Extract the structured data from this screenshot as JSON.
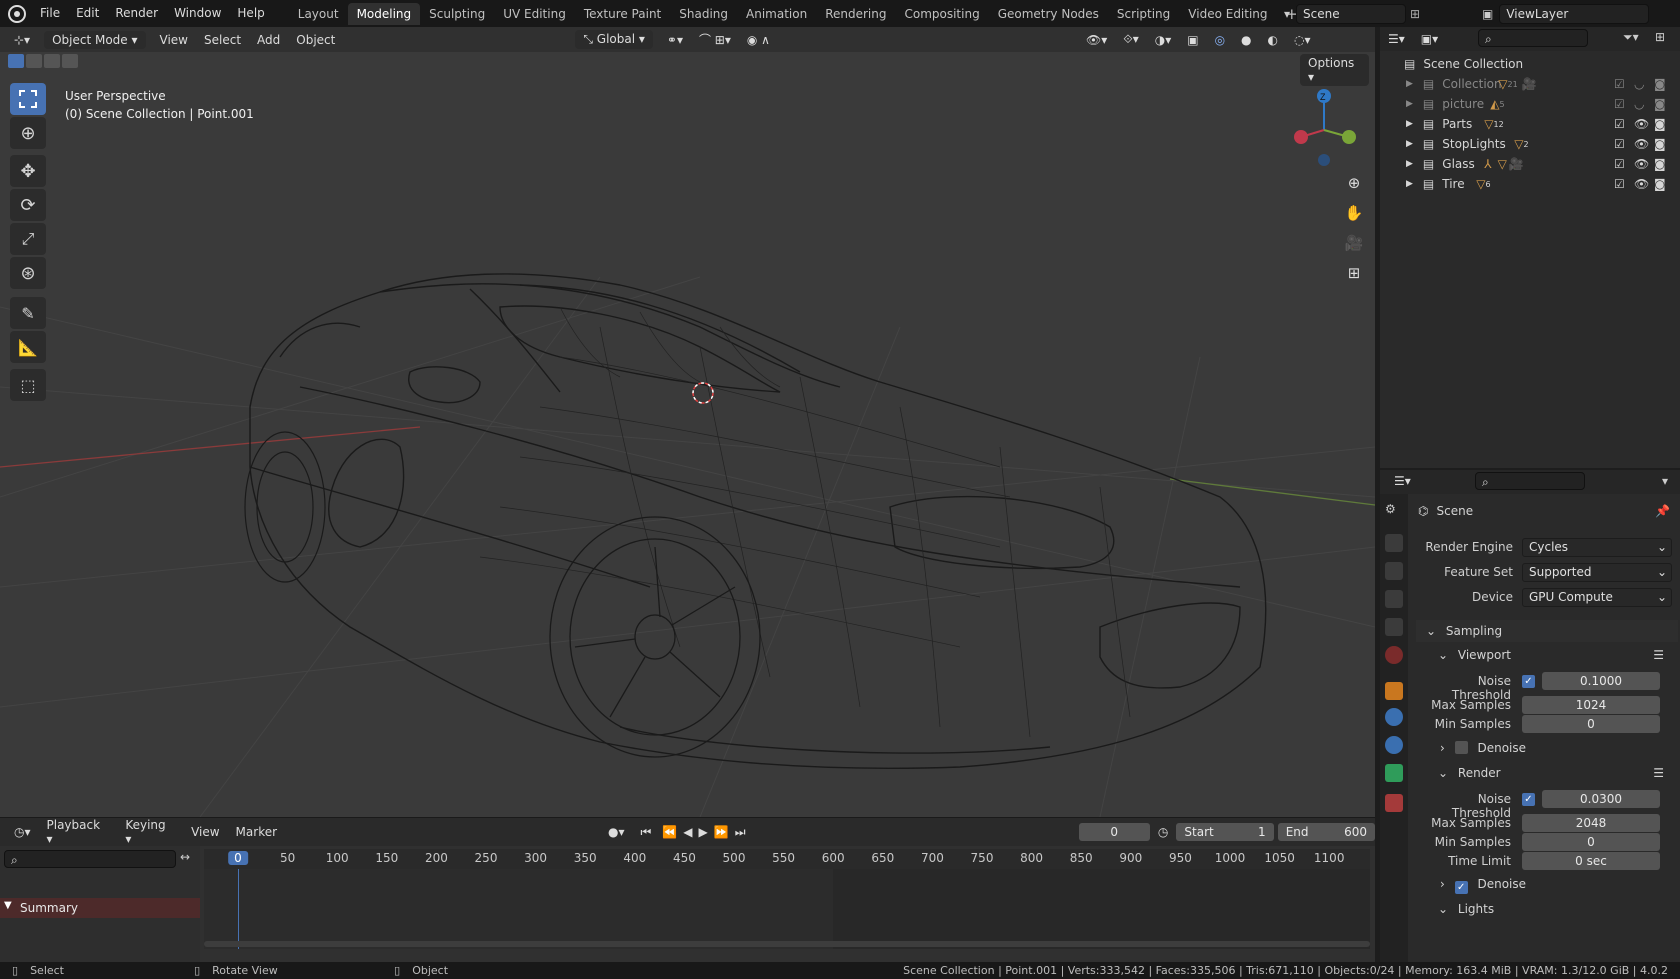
{
  "menu": [
    "File",
    "Edit",
    "Render",
    "Window",
    "Help"
  ],
  "workspaces": [
    "Layout",
    "Modeling",
    "Sculpting",
    "UV Editing",
    "Texture Paint",
    "Shading",
    "Animation",
    "Rendering",
    "Compositing",
    "Geometry Nodes",
    "Scripting",
    "Video Editing"
  ],
  "active_workspace": "Modeling",
  "scene_name": "Scene",
  "view_layer": "ViewLayer",
  "viewport": {
    "mode": "Object Mode",
    "menus": [
      "View",
      "Select",
      "Add",
      "Object"
    ],
    "transform_orientation": "Global",
    "options_label": "Options",
    "info_line1": "User Perspective",
    "info_line2": "(0) Scene Collection | Point.001",
    "gizmo_z": "Z"
  },
  "timeline": {
    "menus": [
      "Playback",
      "Keying",
      "View",
      "Marker"
    ],
    "current_frame": "0",
    "start_label": "Start",
    "start": "1",
    "end_label": "End",
    "end": "600",
    "ticks": [
      "0",
      "50",
      "100",
      "150",
      "200",
      "250",
      "300",
      "350",
      "400",
      "450",
      "500",
      "550",
      "600",
      "650",
      "700",
      "750",
      "800",
      "850",
      "900",
      "950",
      "1000",
      "1050",
      "1100"
    ],
    "summary": "Summary"
  },
  "outliner": {
    "root": "Scene Collection",
    "items": [
      {
        "name": "Collection",
        "count": "21"
      },
      {
        "name": "picture",
        "count": "5"
      },
      {
        "name": "Parts",
        "count": "12"
      },
      {
        "name": "StopLights",
        "count": "2"
      },
      {
        "name": "Glass",
        "count": ""
      },
      {
        "name": "Tire",
        "count": "6"
      }
    ]
  },
  "properties": {
    "context": "Scene",
    "render_engine_label": "Render Engine",
    "render_engine": "Cycles",
    "feature_set_label": "Feature Set",
    "feature_set": "Supported",
    "device_label": "Device",
    "device": "GPU Compute",
    "sampling": "Sampling",
    "viewport": "Viewport",
    "noise_threshold_label": "Noise Threshold",
    "vp_noise_threshold": "0.1000",
    "max_samples_label": "Max Samples",
    "vp_max_samples": "1024",
    "min_samples_label": "Min Samples",
    "vp_min_samples": "0",
    "denoise_label": "Denoise",
    "render": "Render",
    "r_noise_threshold": "0.0300",
    "r_max_samples": "2048",
    "r_min_samples": "0",
    "time_limit_label": "Time Limit",
    "r_time_limit": "0 sec",
    "lights": "Lights"
  },
  "status": {
    "select": "Select",
    "rotate": "Rotate View",
    "object": "Object",
    "info": "Scene Collection | Point.001 | Verts:333,542 | Faces:335,506 | Tris:671,110 | Objects:0/24 | Memory: 163.4 MiB | VRAM: 1.3/12.0 GiB | 4.0.2"
  },
  "colors": {
    "accent": "#4772b3",
    "selected_frame": "#4772b3",
    "summary_bg": "#4d2a2a"
  }
}
